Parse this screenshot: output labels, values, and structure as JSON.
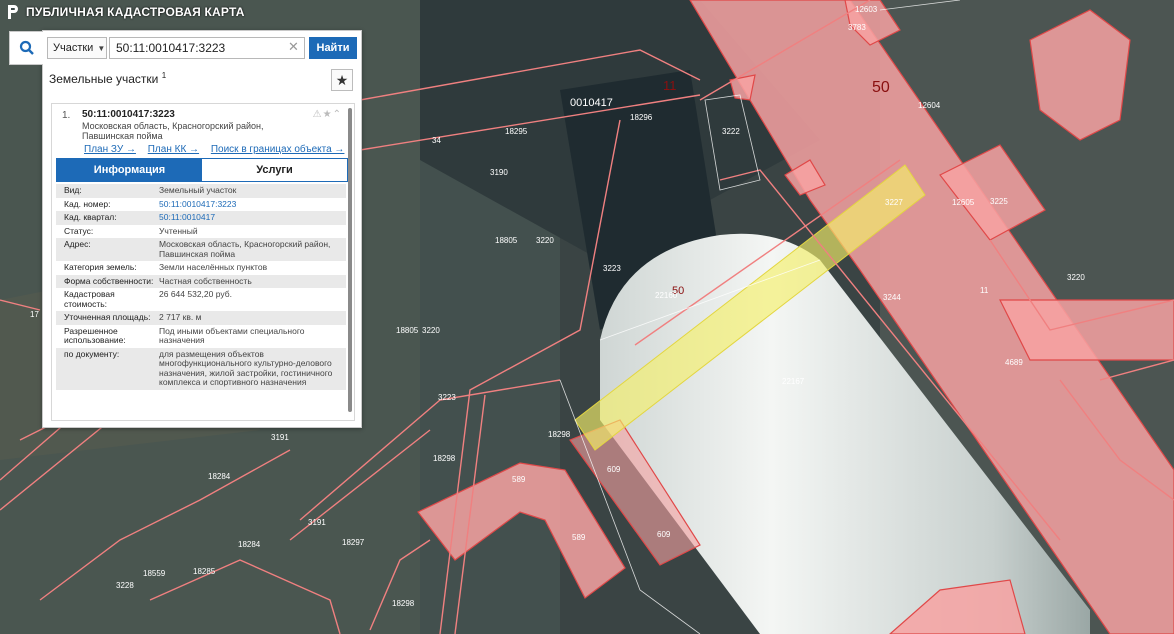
{
  "app": {
    "title": "ПУБЛИЧНАЯ КАДАСТРОВАЯ КАРТА"
  },
  "search": {
    "category": "Участки",
    "value": "50:11:0010417:3223",
    "button": "Найти"
  },
  "section": {
    "title": "Земельные участки",
    "count": "1"
  },
  "result": {
    "index": "1.",
    "cadnum": "50:11:0010417:3223",
    "address": "Московская область, Красногорский район, Павшинская пойма",
    "links": [
      "План ЗУ →",
      "План КК →",
      "Поиск в границах объекта →"
    ]
  },
  "tabs": [
    "Информация",
    "Услуги"
  ],
  "attributes": [
    {
      "k": "Вид:",
      "v": "Земельный участок"
    },
    {
      "k": "Кад. номер:",
      "v": "50:11:0010417:3223"
    },
    {
      "k": "Кад. квартал:",
      "v": "50:11:0010417"
    },
    {
      "k": "Статус:",
      "v": "Учтенный"
    },
    {
      "k": "Адрес:",
      "v": "Московская область, Красногорский район, Павшинская пойма"
    },
    {
      "k": "Категория земель:",
      "v": "Земли населённых пунктов"
    },
    {
      "k": "Форма собственности:",
      "v": "Частная собственность"
    },
    {
      "k": "Кадастровая стоимость:",
      "v": "26 644 532,20 руб."
    },
    {
      "k": "Уточненная площадь:",
      "v": "2 717 кв. м"
    },
    {
      "k": "Разрешенное использование:",
      "v": "Под иными объектами специального назначения"
    },
    {
      "k": "по документу:",
      "v": "для размещения объектов многофункционального культурно-делового назначения, жилой застройки, гостиничного комплекса и спортивного назначения"
    }
  ],
  "map_labels": [
    "0010417",
    "11",
    "50",
    "18296",
    "3222",
    "12603",
    "3783",
    "12604",
    "12605",
    "3225",
    "18295",
    "34",
    "3190",
    "18805",
    "3220",
    "3223",
    "50",
    "22160",
    "3227",
    "3244",
    "3220",
    "4689",
    "18805",
    "3220",
    "3223",
    "22167",
    "609",
    "18298",
    "3191",
    "18298",
    "589",
    "589",
    "609",
    "18284",
    "3191",
    "18297",
    "18284",
    "18559",
    "18285",
    "3228",
    "18298",
    "17",
    "11"
  ],
  "colors": {
    "accent": "#1d6ab7",
    "parcel_fill": "#f7a2a2",
    "parcel_stroke": "#e04848",
    "highlight": "#f4f06a"
  }
}
